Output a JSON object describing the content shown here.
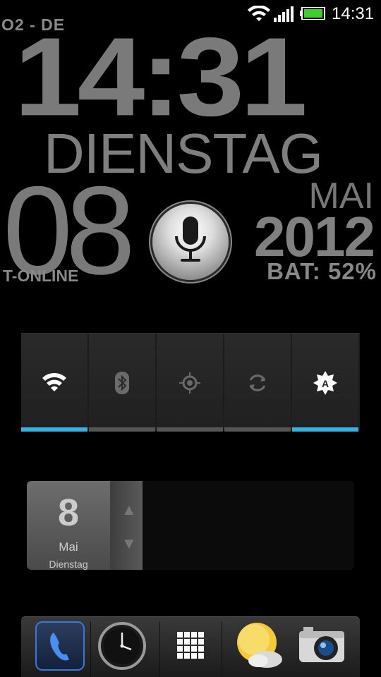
{
  "status_bar": {
    "time": "14:31",
    "icons": [
      "wifi-icon",
      "signal-icon",
      "battery-icon"
    ]
  },
  "clock_widget": {
    "carrier": "O2 - DE",
    "time": "14:31",
    "day_name": "DIENSTAG",
    "month": "MAI",
    "day_number": "08",
    "year": "2012",
    "email": "T-ONLINE",
    "battery": "BAT: 52%"
  },
  "power_widget": {
    "toggles": [
      {
        "name": "wifi",
        "icon": "wifi-icon",
        "on": true
      },
      {
        "name": "bluetooth",
        "icon": "bluetooth-icon",
        "on": false
      },
      {
        "name": "gps",
        "icon": "gps-icon",
        "on": false
      },
      {
        "name": "sync",
        "icon": "sync-icon",
        "on": false
      },
      {
        "name": "brightness",
        "icon": "auto-brightness-icon",
        "on": true
      }
    ],
    "accent_color": "#35b2e0"
  },
  "calendar_widget": {
    "day": "8",
    "month": "Mai",
    "weekday": "Dienstag"
  },
  "dock": {
    "items": [
      "phone-icon",
      "clock-app-icon",
      "app-drawer-icon",
      "weather-icon",
      "camera-icon"
    ]
  }
}
